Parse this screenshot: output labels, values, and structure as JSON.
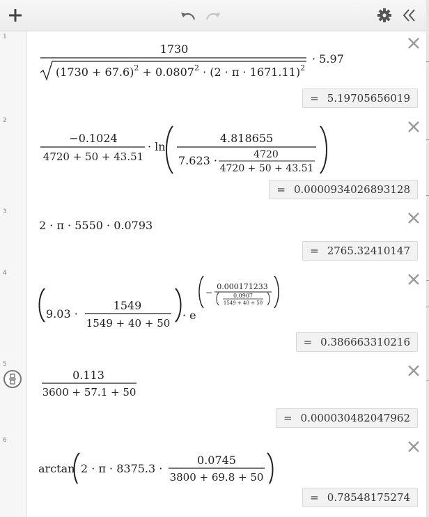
{
  "toolbar": {
    "add_icon": "plus-icon",
    "undo_icon": "undo-icon",
    "redo_icon": "redo-icon",
    "settings_icon": "gear-icon",
    "collapse_icon": "double-chevron-left-icon"
  },
  "expressions": [
    {
      "number": "1",
      "numerator": "1730",
      "radicand": {
        "part1": "(1730 + 67.6)",
        "exp1": "2",
        "part2": " + 0.0807",
        "exp2": "2",
        "part3": " · (2 · π · 1671.11)",
        "exp3": "2"
      },
      "multiplier": "· 5.97",
      "result": "5.19705656019"
    },
    {
      "number": "2",
      "coef_num": "−0.1024",
      "coef_den": "4720 + 50 + 43.51",
      "ln": "· ln",
      "inner_num": "4.818655",
      "inner_den_prefix": "7.623 ·",
      "inner_den_num": "4720",
      "inner_den_den": "4720 + 50 + 43.51",
      "result": "0.0000934026893128"
    },
    {
      "number": "3",
      "text": "2 · π · 5550 · 0.0793",
      "result": "2765.32410147"
    },
    {
      "number": "4",
      "prefix": "9.03 ·",
      "frac_num": "1549",
      "frac_den": "1549 + 40 + 50",
      "e_part": "· e",
      "exp_minus": "−",
      "exp_num": "0.000171233",
      "exp_den_num": "0.0907",
      "exp_den_den": "1549 + 40 + 50",
      "result": "0.386663310216"
    },
    {
      "number": "5",
      "numerator": "0.113",
      "denominator": "3600 + 57.1 + 50",
      "result": "0.000030482047962"
    },
    {
      "number": "6",
      "func": "arctan",
      "prefix": "2 · π · 8375.3 ·",
      "frac_num": "0.0745",
      "frac_den": "3800 + 69.8 + 50",
      "result": "0.78548175274"
    }
  ]
}
